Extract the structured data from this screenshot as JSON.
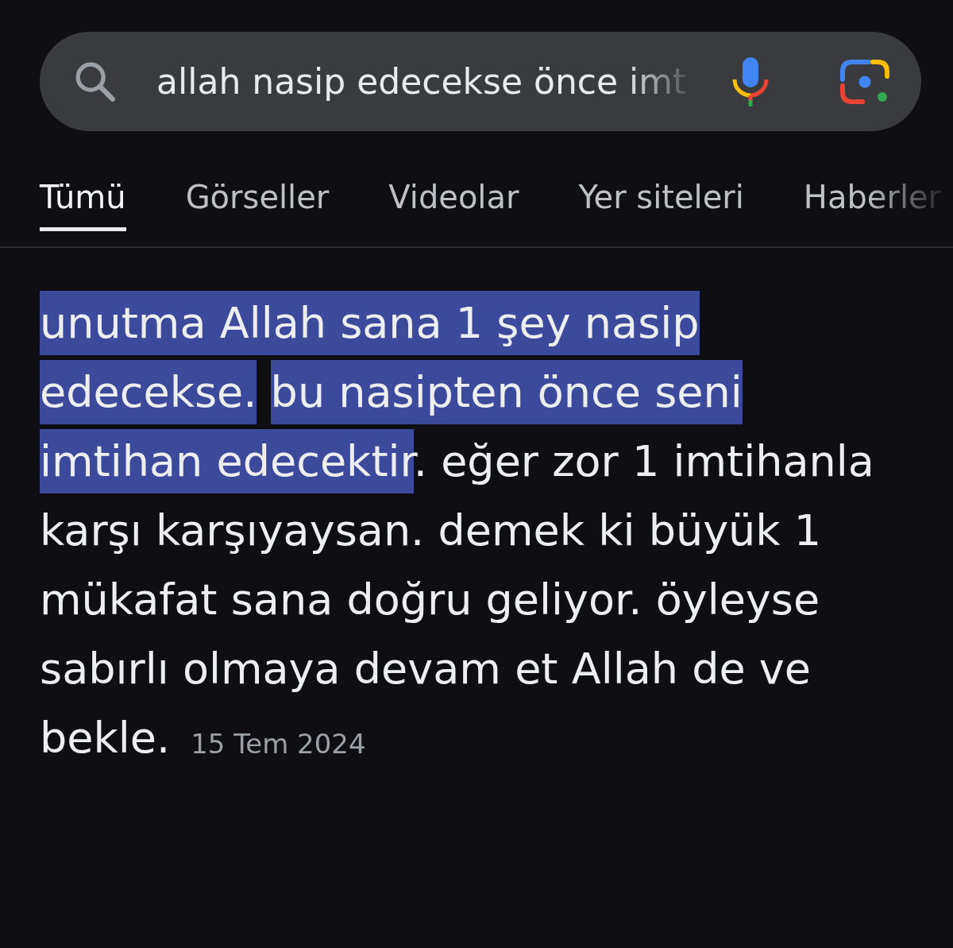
{
  "search": {
    "query": "allah nasip edecekse önce imt"
  },
  "tabs": [
    {
      "label": "Tümü",
      "selected": true
    },
    {
      "label": "Görseller",
      "selected": false
    },
    {
      "label": "Videolar",
      "selected": false
    },
    {
      "label": "Yer siteleri",
      "selected": false
    },
    {
      "label": "Haberler",
      "selected": false
    }
  ],
  "snippet": {
    "segments": [
      {
        "text": "unutma Allah sana 1 şey nasip edecekse. ",
        "highlighted": true
      },
      {
        "text": "bu nasipten önce seni imtihan edecektir",
        "highlighted": true
      },
      {
        "text": ". eğer zor 1 imtihanla karşı karşıyaysan. demek ki büyük 1 mükafat sana doğru geliyor. öyleyse sabırlı olmaya devam et Allah de ve bekle.",
        "highlighted": false
      }
    ],
    "date": "15 Tem 2024"
  }
}
